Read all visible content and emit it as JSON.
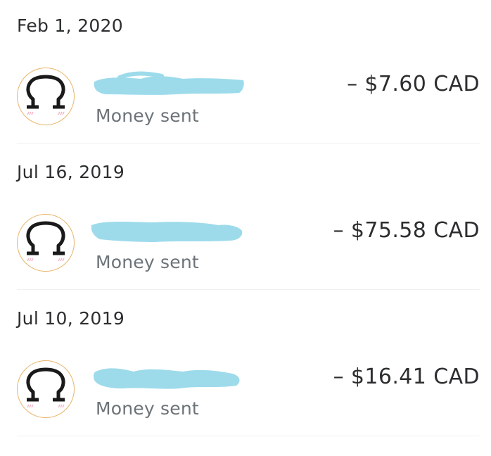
{
  "transactions": [
    {
      "date": "Feb 1, 2020",
      "status": "Money sent",
      "amount": "– $7.60 CAD",
      "avatar_icon": "omega-face-avatar-icon",
      "name_redacted": true
    },
    {
      "date": "Jul 16, 2019",
      "status": "Money sent",
      "amount": "– $75.58 CAD",
      "avatar_icon": "omega-face-avatar-icon",
      "name_redacted": true
    },
    {
      "date": "Jul 10, 2019",
      "status": "Money sent",
      "amount": "– $16.41 CAD",
      "avatar_icon": "omega-face-avatar-icon",
      "name_redacted": true
    }
  ],
  "colors": {
    "redaction": "#9ddbeb",
    "avatar_border": "#e9b468",
    "blush": "#f4b6c6",
    "text_primary": "#2c2e2f",
    "text_secondary": "#6c7378"
  }
}
